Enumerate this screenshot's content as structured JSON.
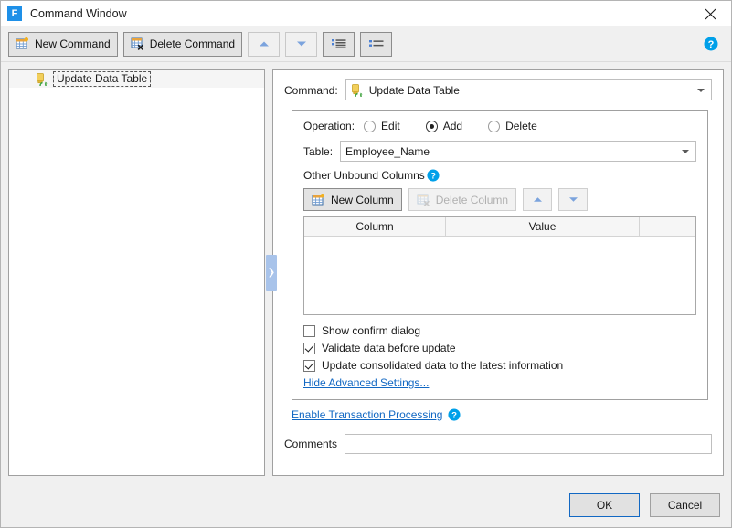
{
  "window": {
    "title": "Command Window",
    "logo_letter": "F",
    "close_icon": "close-icon"
  },
  "toolbar": {
    "new_command": "New Command",
    "delete_command": "Delete Command",
    "move_up_icon": "arrow-up-icon",
    "move_down_icon": "arrow-down-icon",
    "expand_all_icon": "expand-all-icon",
    "collapse_all_icon": "collapse-all-icon",
    "help_icon": "help-icon"
  },
  "tree": {
    "items": [
      {
        "label": "Update Data Table",
        "icon": "update-data-table-icon",
        "selected": true
      }
    ]
  },
  "splitter": {
    "chevron": "❯"
  },
  "panel": {
    "command_label": "Command:",
    "command_value": "Update Data Table",
    "operation_label": "Operation:",
    "operations": [
      {
        "label": "Edit",
        "checked": false
      },
      {
        "label": "Add",
        "checked": true
      },
      {
        "label": "Delete",
        "checked": false
      }
    ],
    "table_label": "Table:",
    "table_value": "Employee_Name",
    "unbound_label": "Other Unbound Columns",
    "unbound_help_icon": "help-icon",
    "new_column": "New Column",
    "delete_column": "Delete Column",
    "col_up_icon": "arrow-up-icon",
    "col_down_icon": "arrow-down-icon",
    "grid": {
      "headers": [
        "Column",
        "Value",
        ""
      ],
      "rows": []
    },
    "checkboxes": [
      {
        "label": "Show confirm dialog",
        "checked": false
      },
      {
        "label": "Validate data before update",
        "checked": true
      },
      {
        "label": "Update consolidated data to the latest information",
        "checked": true
      }
    ],
    "advanced_link": "Hide Advanced Settings...",
    "transaction_link": "Enable Transaction Processing",
    "transaction_help_icon": "help-icon",
    "comments_label": "Comments",
    "comments_value": "",
    "comments_placeholder": ""
  },
  "footer": {
    "ok": "OK",
    "cancel": "Cancel"
  },
  "colors": {
    "accent": "#1e90e8",
    "link": "#1268c3",
    "help": "#00a0e9",
    "splitter": "#a8c3ea",
    "window_bg": "#f0f0f0"
  }
}
